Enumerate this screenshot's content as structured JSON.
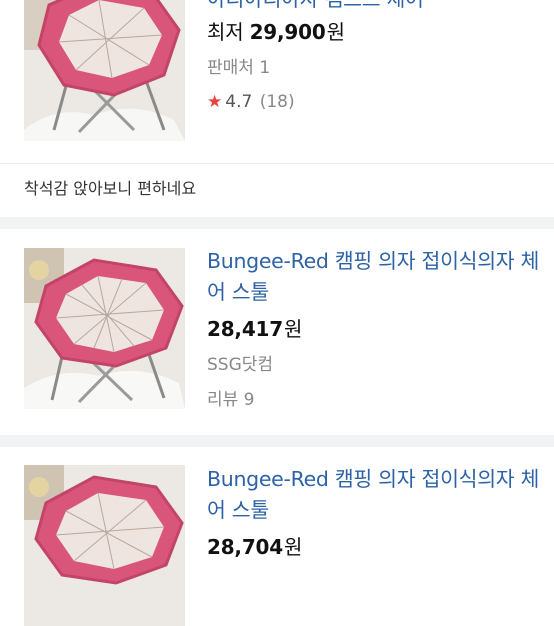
{
  "card1": {
    "title_partial": "아리아리아자 캠프스 체어",
    "price_prefix": "최저",
    "price": "29,900",
    "price_unit": "원",
    "sellers": "판매처 1",
    "rating_star": "★",
    "rating": "4.7",
    "rating_count": "(18)",
    "review_text": "착석감 앉아보니 편하네요"
  },
  "card2": {
    "title": "Bungee-Red 캠핑 의자 접이식의자 체어 스툴",
    "price": "28,417",
    "price_unit": "원",
    "seller": "SSG닷컴",
    "reviews": "리뷰 9"
  },
  "card3": {
    "title": "Bungee-Red 캠핑 의자 접이식의자 체어 스툴",
    "price": "28,704",
    "price_unit": "원"
  },
  "colors": {
    "title_link": "#2d63a6",
    "star": "#e8423c",
    "chair_fabric": "#d9567a",
    "section_gap": "#f1f2f4"
  }
}
